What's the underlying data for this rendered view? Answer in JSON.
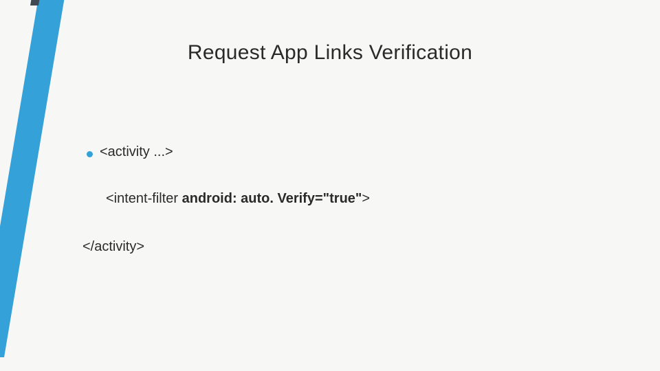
{
  "slide": {
    "title": "Request App Links Verification",
    "line1": "<activity ...>",
    "line2_prefix": "<intent-filter ",
    "line2_bold": "android: auto. Verify=\"true\"",
    "line2_suffix": ">",
    "line3": "</activity>"
  },
  "decor": {
    "accent_color": "#34a1d8",
    "dark_color": "#3f4a52"
  }
}
